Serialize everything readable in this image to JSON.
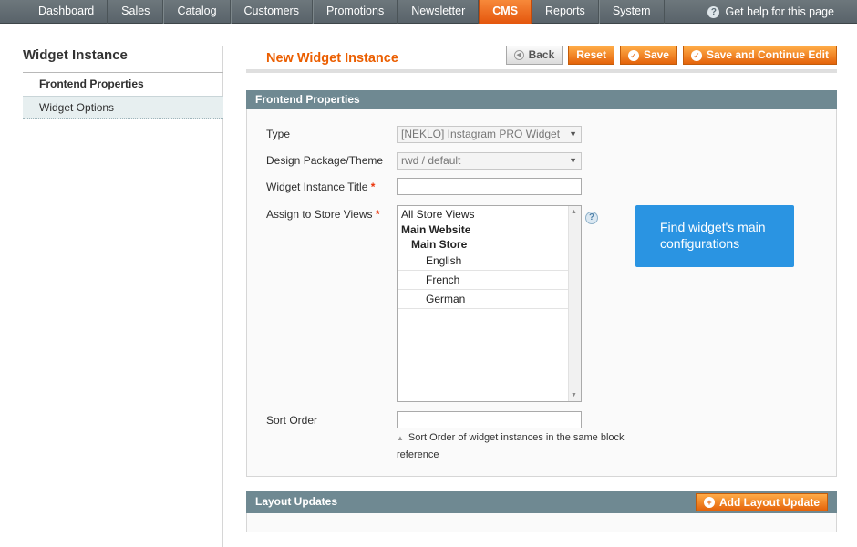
{
  "nav": {
    "items": [
      "Dashboard",
      "Sales",
      "Catalog",
      "Customers",
      "Promotions",
      "Newsletter",
      "CMS",
      "Reports",
      "System"
    ],
    "active": "CMS",
    "help_icon": "question-circle-icon",
    "help_text": "Get help for this page"
  },
  "sidebar": {
    "title": "Widget Instance",
    "tabs": [
      "Frontend Properties",
      "Widget Options"
    ]
  },
  "header": {
    "title": "New Widget Instance",
    "buttons": {
      "back": "Back",
      "reset": "Reset",
      "save": "Save",
      "save_continue": "Save and Continue Edit"
    }
  },
  "frontend": {
    "section_title": "Frontend Properties",
    "type": {
      "label": "Type",
      "value": "[NEKLO] Instagram PRO Widget"
    },
    "theme": {
      "label": "Design Package/Theme",
      "value": "rwd / default"
    },
    "title_field": {
      "label": "Widget Instance Title",
      "required_mark": "*",
      "value": ""
    },
    "store_views": {
      "label": "Assign to Store Views",
      "required_mark": "*",
      "all": "All Store Views",
      "website": "Main Website",
      "store": "Main Store",
      "options": [
        "English",
        "French",
        "German"
      ]
    },
    "sort_order": {
      "label": "Sort Order",
      "value": "",
      "note": "Sort Order of widget instances in the same block reference"
    },
    "tooltip": "Find widget's main configurations"
  },
  "layout": {
    "section_title": "Layout Updates",
    "add_button": "Add Layout Update"
  },
  "colors": {
    "accent": "#eb5e00",
    "button": "#e4630a",
    "section_header": "#6f8992",
    "tooltip": "#2a94e2"
  }
}
